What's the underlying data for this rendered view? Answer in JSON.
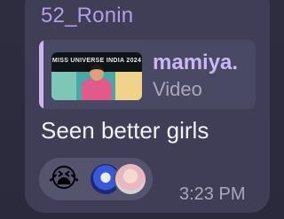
{
  "message": {
    "sender": "52_Ronin",
    "reply": {
      "author": "mamiya.",
      "media_type": "Video",
      "thumbnail_caption": "MISS UNIVERSE INDIA 2024"
    },
    "text": "Seen better girls",
    "time": "3:23 PM",
    "reactions": [
      {
        "type": "emoji",
        "value": "😭"
      },
      {
        "type": "avatar",
        "icon": "reactor-avatar"
      },
      {
        "type": "avatar",
        "icon": "reactor-avatar"
      }
    ]
  },
  "colors": {
    "background": "#2b2a3c",
    "bubble": "#3f3e56",
    "sender": "#b49ee6",
    "reply_accent": "#c9b6f2",
    "text": "#f2f1f7",
    "muted": "#a9a7bd"
  }
}
